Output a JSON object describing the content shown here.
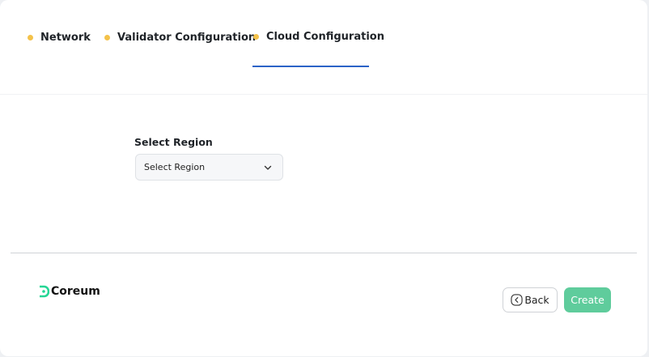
{
  "tabs": {
    "network": "Network",
    "validator": "Validator Configuration",
    "cloud": "Cloud Configuration",
    "active": "cloud",
    "dot_color": "#f4c24a"
  },
  "form": {
    "region_label": "Select Region",
    "region_value": "Select Region"
  },
  "footer": {
    "brand": "Coreum",
    "brand_icon": "coreum-logo-icon",
    "back_label": "Back",
    "create_label": "Create",
    "create_color": "#5fcc9c"
  }
}
